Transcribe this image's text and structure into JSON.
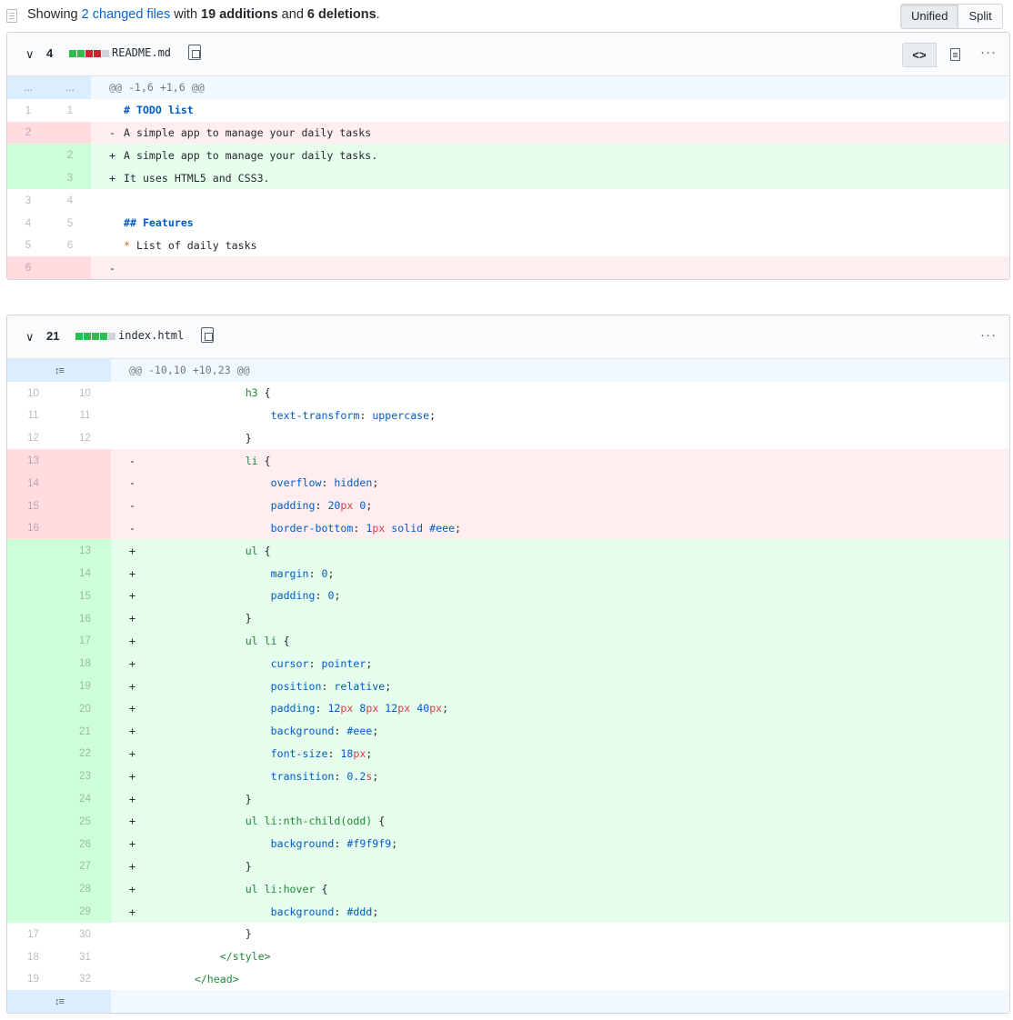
{
  "summary": {
    "prefix": "Showing ",
    "files_link": "2 changed files",
    "mid1": " with ",
    "additions": "19 additions",
    "mid2": " and ",
    "deletions": "6 deletions",
    "suffix": "."
  },
  "view_toggle": {
    "unified": "Unified",
    "split": "Split"
  },
  "icons": {
    "file": "file-icon",
    "chevron": "chevron-down-icon",
    "copy": "clipboard-icon",
    "code": "code-icon",
    "rich": "file-text-icon",
    "more": "kebab-icon",
    "expand": "unfold-icon"
  },
  "colors": {
    "addition": "#2cbe4e",
    "deletion": "#cb2431",
    "add_bg": "#e6ffed",
    "del_bg": "#ffeef0",
    "hunk_bg": "#f1f8ff"
  },
  "files": [
    {
      "change_count": "4",
      "blocks": [
        "add",
        "add",
        "del",
        "del",
        "neu"
      ],
      "name": "README.md",
      "code_toggle": "<>",
      "more": "···",
      "lines": [
        {
          "type": "hunk",
          "old": "...",
          "new": "...",
          "text": "@@ -1,6 +1,6 @@"
        },
        {
          "type": "ctx",
          "old": "1",
          "new": "1",
          "sign": " ",
          "text": "# TODO list",
          "style": "kw"
        },
        {
          "type": "del",
          "old": "2",
          "new": "",
          "sign": "-",
          "text": "A simple app to manage your daily tasks"
        },
        {
          "type": "add",
          "old": "",
          "new": "2",
          "sign": "+",
          "text": "A simple app to manage your daily tasks."
        },
        {
          "type": "add",
          "old": "",
          "new": "3",
          "sign": "+",
          "text": "It uses HTML5 and CSS3."
        },
        {
          "type": "ctx",
          "old": "3",
          "new": "4",
          "sign": " ",
          "text": ""
        },
        {
          "type": "ctx",
          "old": "4",
          "new": "5",
          "sign": " ",
          "text": "## Features",
          "style": "kw"
        },
        {
          "type": "ctx",
          "old": "5",
          "new": "6",
          "sign": " ",
          "text": "List of daily tasks",
          "bullet": "*"
        },
        {
          "type": "del",
          "old": "6",
          "new": "",
          "sign": "-",
          "text": ""
        }
      ]
    },
    {
      "change_count": "21",
      "blocks": [
        "add",
        "add",
        "add",
        "add",
        "neu"
      ],
      "name": "index.html",
      "more": "···",
      "lines": [
        {
          "type": "hunk",
          "old": "",
          "new": "",
          "text": "@@ -10,10 +10,23 @@",
          "expand": true
        },
        {
          "type": "ctx",
          "old": "10",
          "new": "10",
          "sign": " ",
          "indent": 16,
          "parts": [
            [
              "sel",
              "h3"
            ],
            [
              "",
              " {"
            ]
          ]
        },
        {
          "type": "ctx",
          "old": "11",
          "new": "11",
          "sign": " ",
          "indent": 20,
          "parts": [
            [
              "prop",
              "text-transform"
            ],
            [
              "",
              ": "
            ],
            [
              "prop",
              "uppercase"
            ],
            [
              "",
              ";"
            ]
          ]
        },
        {
          "type": "ctx",
          "old": "12",
          "new": "12",
          "sign": " ",
          "indent": 16,
          "parts": [
            [
              "",
              "}"
            ]
          ]
        },
        {
          "type": "del",
          "old": "13",
          "new": "",
          "sign": "-",
          "indent": 16,
          "parts": [
            [
              "sel",
              "li"
            ],
            [
              "",
              " {"
            ]
          ]
        },
        {
          "type": "del",
          "old": "14",
          "new": "",
          "sign": "-",
          "indent": 20,
          "parts": [
            [
              "prop",
              "overflow"
            ],
            [
              "",
              ": "
            ],
            [
              "prop",
              "hidden"
            ],
            [
              "",
              ";"
            ]
          ]
        },
        {
          "type": "del",
          "old": "15",
          "new": "",
          "sign": "-",
          "indent": 20,
          "parts": [
            [
              "prop",
              "padding"
            ],
            [
              "",
              ": "
            ],
            [
              "prop",
              "20"
            ],
            [
              "unit",
              "px"
            ],
            [
              "prop",
              " 0"
            ],
            [
              "",
              ";"
            ]
          ]
        },
        {
          "type": "del",
          "old": "16",
          "new": "",
          "sign": "-",
          "indent": 20,
          "parts": [
            [
              "prop",
              "border-bottom"
            ],
            [
              "",
              ": "
            ],
            [
              "prop",
              "1"
            ],
            [
              "unit",
              "px"
            ],
            [
              "prop",
              " solid #eee"
            ],
            [
              "",
              ";"
            ]
          ]
        },
        {
          "type": "add",
          "old": "",
          "new": "13",
          "sign": "+",
          "indent": 16,
          "parts": [
            [
              "sel",
              "ul"
            ],
            [
              "",
              " {"
            ]
          ]
        },
        {
          "type": "add",
          "old": "",
          "new": "14",
          "sign": "+",
          "indent": 20,
          "parts": [
            [
              "prop",
              "margin"
            ],
            [
              "",
              ": "
            ],
            [
              "prop",
              "0"
            ],
            [
              "",
              ";"
            ]
          ]
        },
        {
          "type": "add",
          "old": "",
          "new": "15",
          "sign": "+",
          "indent": 20,
          "parts": [
            [
              "prop",
              "padding"
            ],
            [
              "",
              ": "
            ],
            [
              "prop",
              "0"
            ],
            [
              "",
              ";"
            ]
          ]
        },
        {
          "type": "add",
          "old": "",
          "new": "16",
          "sign": "+",
          "indent": 16,
          "parts": [
            [
              "",
              "}"
            ]
          ]
        },
        {
          "type": "add",
          "old": "",
          "new": "17",
          "sign": "+",
          "indent": 16,
          "parts": [
            [
              "sel",
              "ul li"
            ],
            [
              "",
              " {"
            ]
          ]
        },
        {
          "type": "add",
          "old": "",
          "new": "18",
          "sign": "+",
          "indent": 20,
          "parts": [
            [
              "prop",
              "cursor"
            ],
            [
              "",
              ": "
            ],
            [
              "prop",
              "pointer"
            ],
            [
              "",
              ";"
            ]
          ]
        },
        {
          "type": "add",
          "old": "",
          "new": "19",
          "sign": "+",
          "indent": 20,
          "parts": [
            [
              "prop",
              "position"
            ],
            [
              "",
              ": "
            ],
            [
              "prop",
              "relative"
            ],
            [
              "",
              ";"
            ]
          ]
        },
        {
          "type": "add",
          "old": "",
          "new": "20",
          "sign": "+",
          "indent": 20,
          "parts": [
            [
              "prop",
              "padding"
            ],
            [
              "",
              ": "
            ],
            [
              "prop",
              "12"
            ],
            [
              "unit",
              "px"
            ],
            [
              "prop",
              " 8"
            ],
            [
              "unit",
              "px"
            ],
            [
              "prop",
              " 12"
            ],
            [
              "unit",
              "px"
            ],
            [
              "prop",
              " 40"
            ],
            [
              "unit",
              "px"
            ],
            [
              "",
              ";"
            ]
          ]
        },
        {
          "type": "add",
          "old": "",
          "new": "21",
          "sign": "+",
          "indent": 20,
          "parts": [
            [
              "prop",
              "background"
            ],
            [
              "",
              ": "
            ],
            [
              "prop",
              "#eee"
            ],
            [
              "",
              ";"
            ]
          ]
        },
        {
          "type": "add",
          "old": "",
          "new": "22",
          "sign": "+",
          "indent": 20,
          "parts": [
            [
              "prop",
              "font-size"
            ],
            [
              "",
              ": "
            ],
            [
              "prop",
              "18"
            ],
            [
              "unit",
              "px"
            ],
            [
              "",
              ";"
            ]
          ]
        },
        {
          "type": "add",
          "old": "",
          "new": "23",
          "sign": "+",
          "indent": 20,
          "parts": [
            [
              "prop",
              "transition"
            ],
            [
              "",
              ": "
            ],
            [
              "prop",
              "0.2"
            ],
            [
              "unit",
              "s"
            ],
            [
              "",
              ";"
            ]
          ]
        },
        {
          "type": "add",
          "old": "",
          "new": "24",
          "sign": "+",
          "indent": 16,
          "parts": [
            [
              "",
              "}"
            ]
          ]
        },
        {
          "type": "add",
          "old": "",
          "new": "25",
          "sign": "+",
          "indent": 16,
          "parts": [
            [
              "sel",
              "ul li:nth-child(odd)"
            ],
            [
              "",
              " {"
            ]
          ]
        },
        {
          "type": "add",
          "old": "",
          "new": "26",
          "sign": "+",
          "indent": 20,
          "parts": [
            [
              "prop",
              "background"
            ],
            [
              "",
              ": "
            ],
            [
              "prop",
              "#f9f9f9"
            ],
            [
              "",
              ";"
            ]
          ]
        },
        {
          "type": "add",
          "old": "",
          "new": "27",
          "sign": "+",
          "indent": 16,
          "parts": [
            [
              "",
              "}"
            ]
          ]
        },
        {
          "type": "add",
          "old": "",
          "new": "28",
          "sign": "+",
          "indent": 16,
          "parts": [
            [
              "sel",
              "ul li:hover"
            ],
            [
              "",
              " {"
            ]
          ]
        },
        {
          "type": "add",
          "old": "",
          "new": "29",
          "sign": "+",
          "indent": 20,
          "parts": [
            [
              "prop",
              "background"
            ],
            [
              "",
              ": "
            ],
            [
              "prop",
              "#ddd"
            ],
            [
              "",
              ";"
            ]
          ]
        },
        {
          "type": "ctx",
          "old": "17",
          "new": "30",
          "sign": " ",
          "indent": 16,
          "parts": [
            [
              "",
              "}"
            ]
          ]
        },
        {
          "type": "ctx",
          "old": "18",
          "new": "31",
          "sign": " ",
          "indent": 12,
          "parts": [
            [
              "tag",
              "</style>"
            ]
          ]
        },
        {
          "type": "ctx",
          "old": "19",
          "new": "32",
          "sign": " ",
          "indent": 8,
          "parts": [
            [
              "tag",
              "</head>"
            ]
          ]
        },
        {
          "type": "hunk",
          "old": "",
          "new": "",
          "text": "",
          "expand": true
        }
      ]
    }
  ]
}
